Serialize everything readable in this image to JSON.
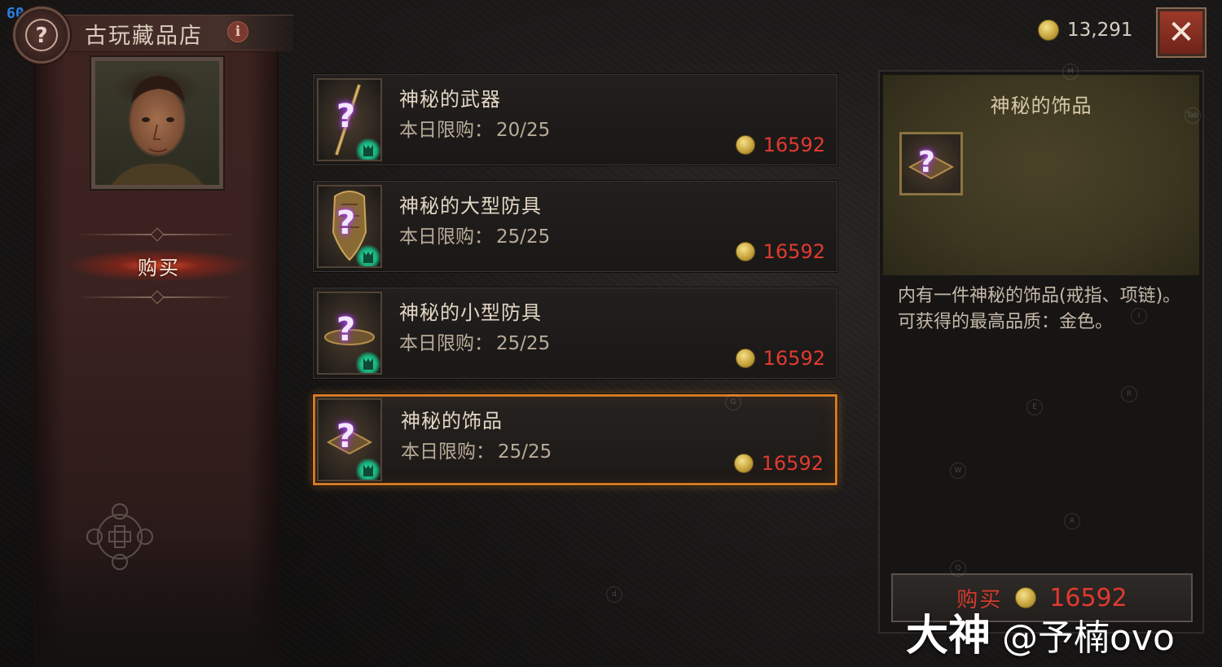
{
  "hud": {
    "fps": "60"
  },
  "shop": {
    "title": "古玩藏品店",
    "info_label": "i",
    "nav_buy_label": "购买"
  },
  "currency": {
    "gold": "13,291",
    "close_label": "✕"
  },
  "items": [
    {
      "name": "神秘的武器",
      "limit_label": "本日限购：",
      "limit": "20/25",
      "price": "16592"
    },
    {
      "name": "神秘的大型防具",
      "limit_label": "本日限购：",
      "limit": "25/25",
      "price": "16592"
    },
    {
      "name": "神秘的小型防具",
      "limit_label": "本日限购：",
      "limit": "25/25",
      "price": "16592"
    },
    {
      "name": "神秘的饰品",
      "limit_label": "本日限购：",
      "limit": "25/25",
      "price": "16592"
    }
  ],
  "selected_index": 3,
  "detail": {
    "title": "神秘的饰品",
    "desc_line1": "内有一件神秘的饰品(戒指、项链)。",
    "desc_line2": "可获得的最高品质：金色。",
    "buy_label": "购买",
    "price": "16592"
  },
  "key_hints": [
    "M",
    "Tab",
    "I",
    "R",
    "E",
    "G",
    "W",
    "A",
    "Q",
    "d"
  ],
  "watermark": {
    "brand": "大神",
    "handle": "@予楠ovo"
  },
  "colors": {
    "price_red": "#e03a30",
    "selected_border": "#d27a24",
    "class_badge_green": "#3ff0b4",
    "mystery_purple": "#b84cff"
  },
  "icons": {
    "shop_emblem": "question-skull-emblem-icon",
    "item": "mystery-question-icon",
    "class_badge": "rogue-class-badge-icon",
    "currency": "gold-coin-icon",
    "close": "close-x-icon",
    "dpad": "dpad-icon"
  }
}
